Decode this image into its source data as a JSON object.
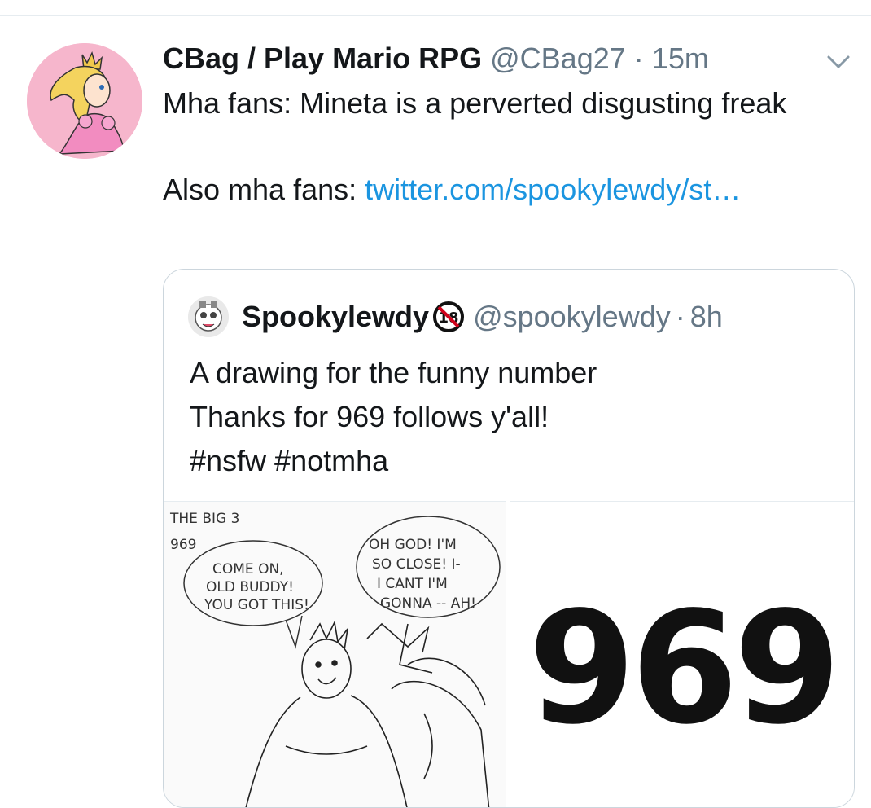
{
  "tweet": {
    "author_name": "CBag / Play Mario RPG",
    "author_handle": "@CBag27",
    "separator": "·",
    "time": "15m",
    "line1": "Mha fans: Mineta is a perverted disgusting freak",
    "line2_prefix": "Also mha fans: ",
    "link_text": "twitter.com/spookylewdy/st…"
  },
  "quoted": {
    "name": "Spookylewdy",
    "handle": "@spookylewdy",
    "separator": "·",
    "time": "8h",
    "lines": [
      "A drawing for the funny number",
      "Thanks for 969 follows y'all!",
      "#nsfw #notmha"
    ],
    "media_number": "969",
    "sketch": {
      "title": "THE BIG 3",
      "subtitle": "969",
      "bubble_left": [
        "COME ON,",
        "OLD BUDDY!",
        "YOU GOT THIS!"
      ],
      "bubble_right": [
        "OH GOD! I'M",
        "SO CLOSE! I-",
        "I CANT I'M",
        "GONNA -- AH!"
      ]
    }
  },
  "icons": {
    "caret": "chevron-down-icon",
    "badge": "18-plus-badge-icon",
    "avatar": "princess-avatar-icon"
  },
  "colors": {
    "text": "#14171a",
    "muted": "#657786",
    "link": "#1b95e0",
    "border": "#ccd6dd",
    "avatar_bg": "#f6b6cc"
  }
}
